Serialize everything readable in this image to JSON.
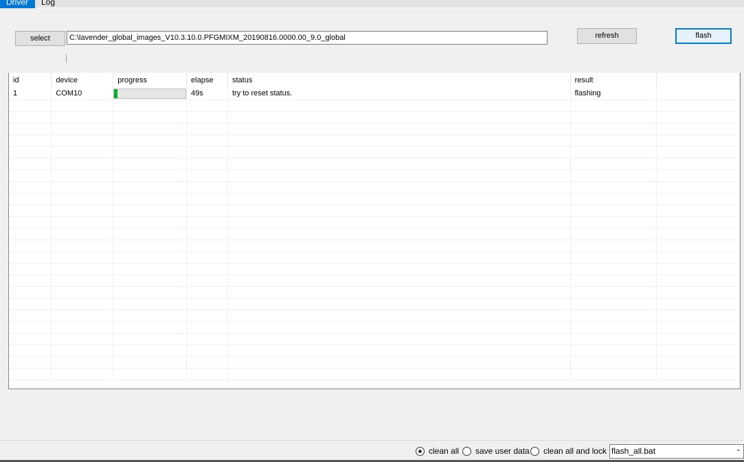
{
  "tabs": [
    {
      "label": "Driver"
    },
    {
      "label": "Log"
    }
  ],
  "toolbar": {
    "select_label": "select",
    "path_value": "C:\\lavender_global_images_V10.3.10.0.PFGMIXM_20190816.0000.00_9.0_global",
    "refresh_label": "refresh",
    "flash_label": "flash"
  },
  "table": {
    "columns": [
      "id",
      "device",
      "progress",
      "elapse",
      "status",
      "result",
      ""
    ],
    "rows": [
      {
        "id": "1",
        "device": "COM10",
        "progress": 0.05,
        "elapse": "49s",
        "status": "try to reset status.",
        "result": "flashing"
      }
    ]
  },
  "footer": {
    "options": [
      {
        "label": "clean all",
        "selected": true
      },
      {
        "label": "save user data",
        "selected": false
      },
      {
        "label": "clean all and lock",
        "selected": false
      }
    ],
    "script_value": "flash_all.bat"
  },
  "colors": {
    "accent": "#0078d7",
    "progress": "#06b025"
  }
}
